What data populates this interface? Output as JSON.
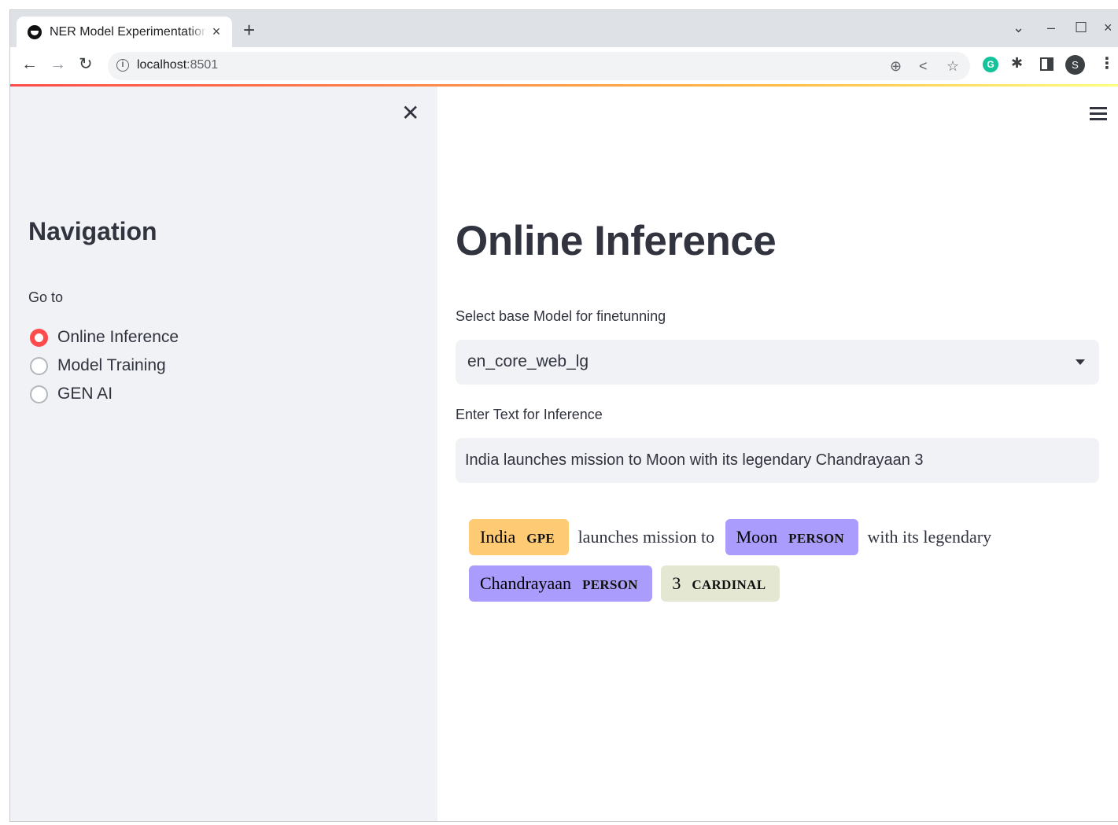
{
  "browser": {
    "tab_title": "NER Model Experimentation",
    "tab_close": "×",
    "new_tab": "+",
    "url_host": "localhost",
    "url_port": ":8501",
    "win_min": "–",
    "win_max": "☐",
    "win_close": "×",
    "win_list": "⌄",
    "avatar_letter": "S",
    "grammarly_letter": "G"
  },
  "sidebar": {
    "title": "Navigation",
    "radio_label": "Go to",
    "options": [
      {
        "label": "Online Inference",
        "checked": true
      },
      {
        "label": "Model Training",
        "checked": false
      },
      {
        "label": "GEN AI",
        "checked": false
      }
    ]
  },
  "main": {
    "title": "Online Inference",
    "select_label": "Select base Model for finetunning",
    "select_value": "en_core_web_lg",
    "text_label": "Enter Text for Inference",
    "text_value": "India launches mission to Moon with its legendary Chandrayaan 3"
  },
  "ner_output": {
    "tokens": [
      {
        "kind": "ent",
        "text": "India",
        "label": "GPE",
        "color": "#feca74"
      },
      {
        "kind": "text",
        "text": "launches mission to"
      },
      {
        "kind": "ent",
        "text": "Moon",
        "label": "PERSON",
        "color": "#aa9cfc"
      },
      {
        "kind": "text",
        "text": "with its legendary"
      },
      {
        "kind": "ent",
        "text": "Chandrayaan",
        "label": "PERSON",
        "color": "#aa9cfc"
      },
      {
        "kind": "ent",
        "text": "3",
        "label": "CARDINAL",
        "color": "#e4e7d2"
      }
    ]
  },
  "colors": {
    "accent": "#ff4b4b",
    "sidebar_bg": "#f0f2f6",
    "text": "#31333f"
  }
}
